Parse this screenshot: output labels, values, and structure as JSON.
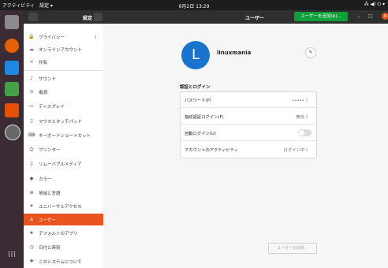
{
  "topbar": {
    "activities": "アクティビティ",
    "app_menu": "設定 ▾",
    "clock": "6月2日 13:29",
    "status": "⁂ ◀) ⏻ ▾"
  },
  "header": {
    "title": "設定",
    "users_title": "ユーザー",
    "add_user_label": "ユーザーを追加(A)...",
    "min": "–",
    "max": "□",
    "close": "×"
  },
  "sidebar": {
    "items": [
      {
        "icon": "🔒",
        "label": "プライバシー",
        "chevron": "〉"
      },
      {
        "icon": "☁",
        "label": "オンラインアカウント"
      },
      {
        "icon": "<",
        "label": "共有"
      },
      {
        "icon": "♪",
        "label": "サウンド"
      },
      {
        "icon": "⊙",
        "label": "電源"
      },
      {
        "icon": "▭",
        "label": "ディスプレイ"
      },
      {
        "icon": "▯",
        "label": "マウスとタッチパッド"
      },
      {
        "icon": "⌨",
        "label": "キーボードショートカット"
      },
      {
        "icon": "⎙",
        "label": "プリンター"
      },
      {
        "icon": "▯",
        "label": "リムーバブルメディア"
      },
      {
        "icon": "◆",
        "label": "カラー"
      },
      {
        "icon": "⊕",
        "label": "地域と言語"
      },
      {
        "icon": "✦",
        "label": "ユニバーサルアクセス"
      },
      {
        "icon": "♙",
        "label": "ユーザー"
      },
      {
        "icon": "★",
        "label": "デフォルトのアプリ"
      },
      {
        "icon": "◷",
        "label": "日付と時刻"
      },
      {
        "icon": "✚",
        "label": "このシステムについて"
      }
    ]
  },
  "user": {
    "initial": "L",
    "name": "linuxmania",
    "edit_icon": "✎"
  },
  "auth": {
    "title": "認証とログイン",
    "rows": [
      {
        "label": "パスワード(P)",
        "value": "•••••  〉"
      },
      {
        "label": "指紋認証ログイン(F)",
        "value": "無効  〉"
      },
      {
        "label": "自動ログイン(U)",
        "value": ""
      },
      {
        "label": "アカウントのアクティビティ",
        "value": "ログイン中  〉"
      }
    ]
  },
  "remove_user_label": "ユーザーを削除...",
  "colors": {
    "accent": "#e95420",
    "add_button": "#0e9f3a",
    "avatar": "#1874cd"
  }
}
